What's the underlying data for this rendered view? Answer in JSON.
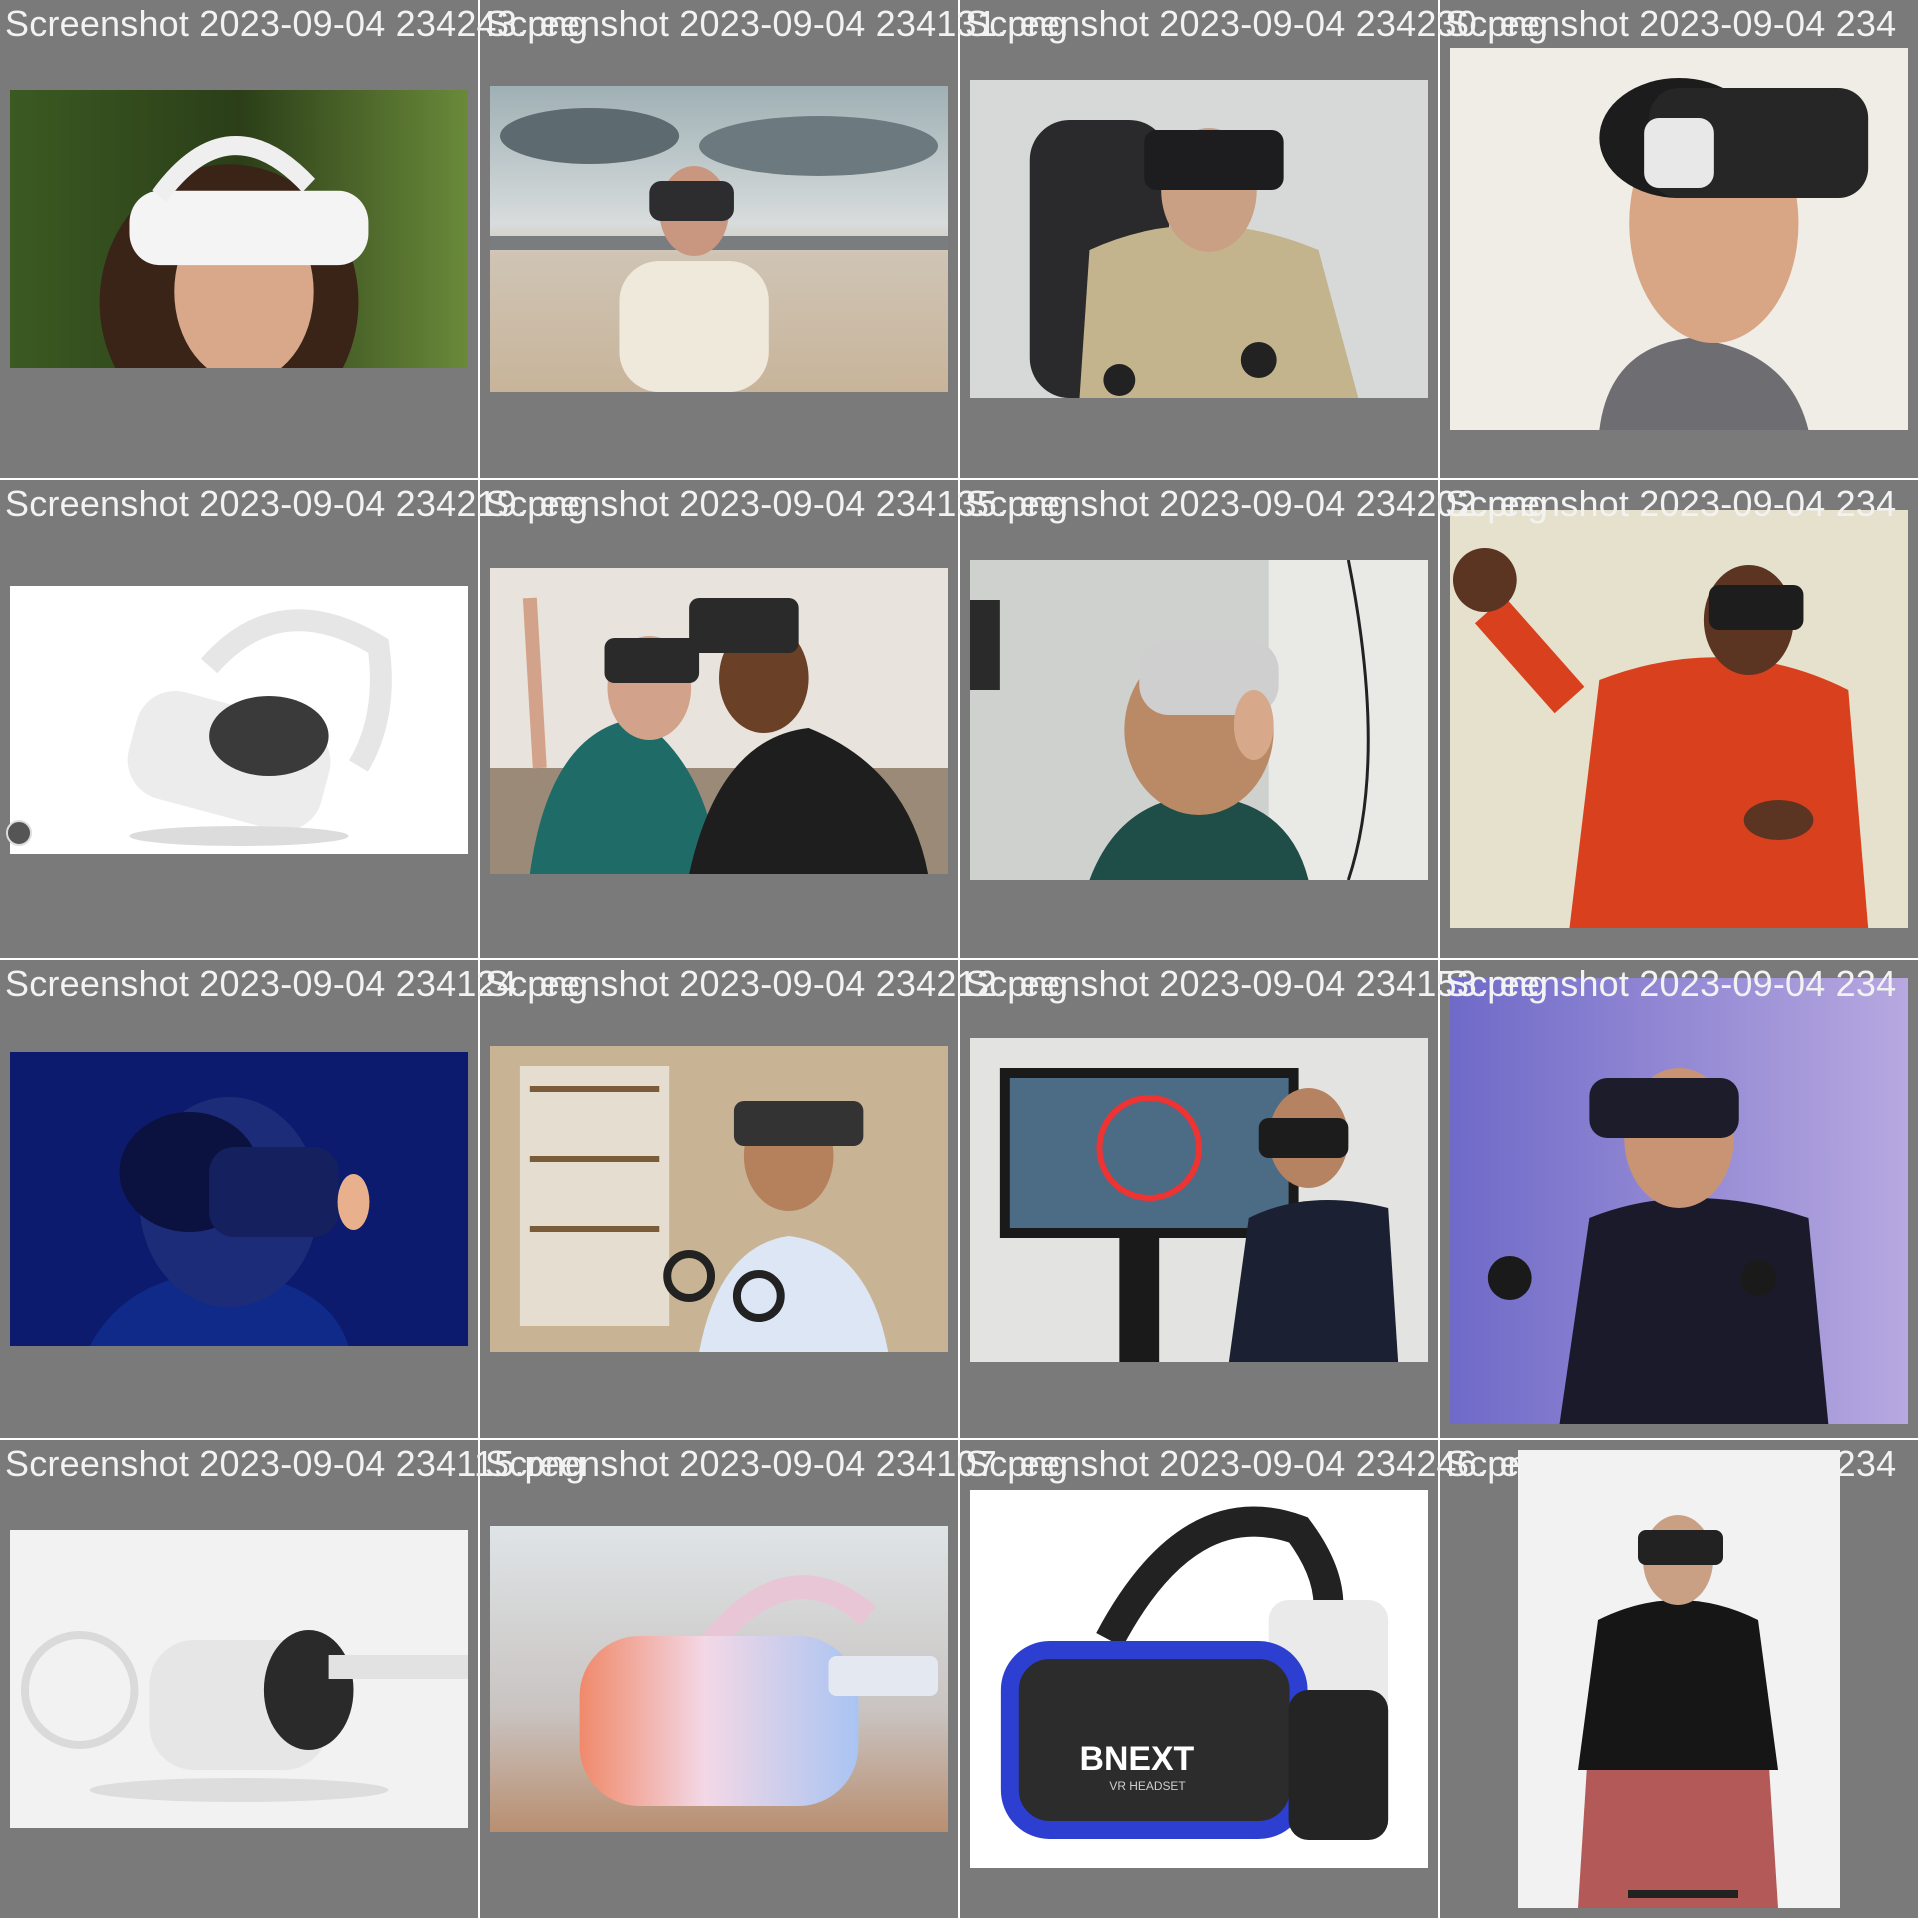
{
  "tiles": [
    {
      "filename": "Screenshot 2023-09-04 234243.png",
      "icon": "woman-white-vr-headset-image"
    },
    {
      "filename": "Screenshot 2023-09-04 234131.png",
      "icon": "girl-fpv-goggles-desert-image"
    },
    {
      "filename": "Screenshot 2023-09-04 234230.png",
      "icon": "man-oculus-rift-chair-image"
    },
    {
      "filename": "Screenshot 2023-09-04 234",
      "icon": "man-gear-vr-headset-image"
    },
    {
      "filename": "Screenshot 2023-09-04 234219.png",
      "icon": "white-quest-headset-product-image"
    },
    {
      "filename": "Screenshot 2023-09-04 234135.png",
      "icon": "two-women-vr-headsets-image"
    },
    {
      "filename": "Screenshot 2023-09-04 234202.png",
      "icon": "woman-oculus-go-headset-image"
    },
    {
      "filename": "Screenshot 2023-09-04 234",
      "icon": "man-red-hoodie-vr-image"
    },
    {
      "filename": "Screenshot 2023-09-04 234124.png",
      "icon": "man-blue-lit-vr-headset-image"
    },
    {
      "filename": "Screenshot 2023-09-04 234212.png",
      "icon": "girl-library-mixed-reality-image"
    },
    {
      "filename": "Screenshot 2023-09-04 234153.png",
      "icon": "man-vr-screen-demo-image"
    },
    {
      "filename": "Screenshot 2023-09-04 234",
      "icon": "man-purple-vr-controllers-image"
    },
    {
      "filename": "Screenshot 2023-09-04 234115.png",
      "icon": "quest-headset-controllers-image"
    },
    {
      "filename": "Screenshot 2023-09-04 234107.png",
      "icon": "gradient-quest-headset-image"
    },
    {
      "filename": "Screenshot 2023-09-04 234246.png",
      "icon": "bnext-vr-headset-product-image"
    },
    {
      "filename": "Screenshot 2023-09-04 234",
      "icon": "man-seated-vr-headset-image"
    }
  ],
  "product_brand_text": "BNEXT",
  "product_sub_text": "VR HEADSET"
}
